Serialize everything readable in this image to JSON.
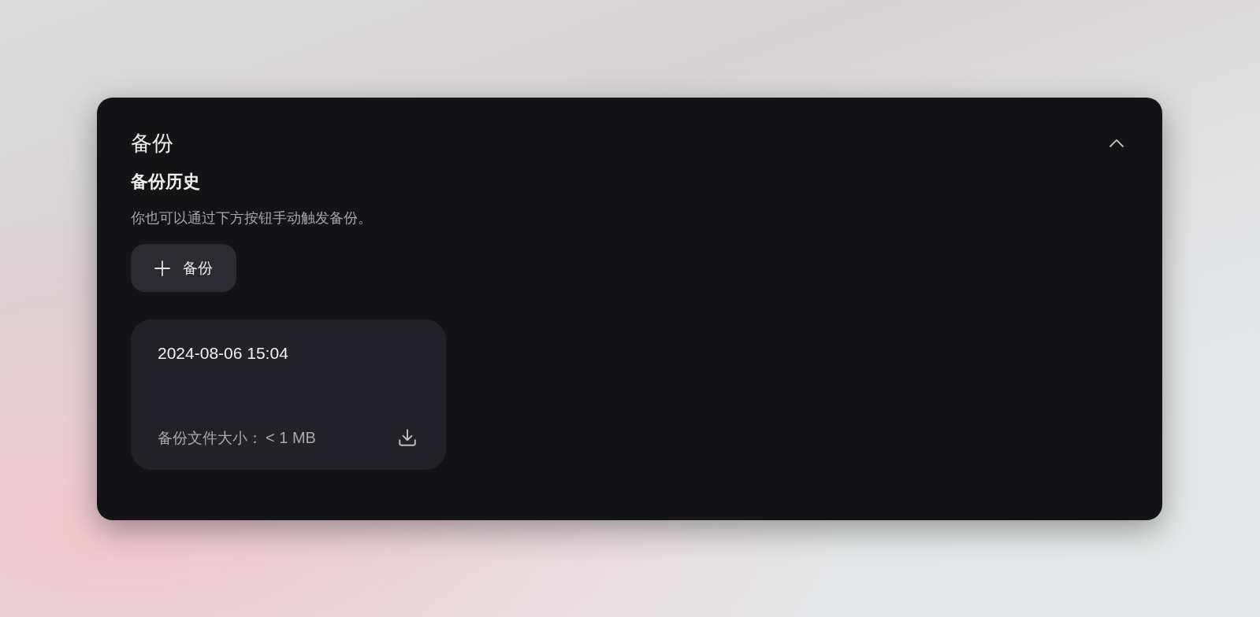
{
  "section": {
    "title": "备份",
    "expanded": true
  },
  "history": {
    "title": "备份历史",
    "description": "你也可以通过下方按钮手动触发备份。",
    "add_button": "备份",
    "backups": [
      {
        "date": "2024-08-06 15:04",
        "size_label": "备份文件大小：",
        "size": "< 1 MB"
      }
    ]
  }
}
